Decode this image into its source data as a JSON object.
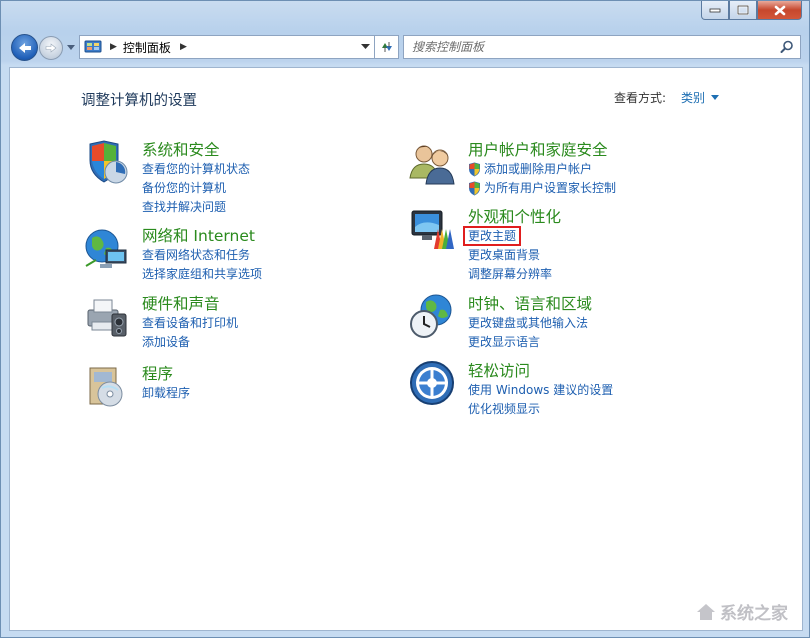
{
  "window": {
    "caption_buttons": [
      "minimize",
      "maximize",
      "close"
    ]
  },
  "nav": {
    "address_path": "控制面板",
    "search_placeholder": "搜索控制面板"
  },
  "header": {
    "title": "调整计算机的设置",
    "view_by_label": "查看方式:",
    "view_by_value": "类别"
  },
  "categories_left": [
    {
      "title": "系统和安全",
      "icon": "system-security-icon",
      "links": [
        "查看您的计算机状态",
        "备份您的计算机",
        "查找并解决问题"
      ]
    },
    {
      "title": "网络和 Internet",
      "icon": "network-icon",
      "links": [
        "查看网络状态和任务",
        "选择家庭组和共享选项"
      ]
    },
    {
      "title": "硬件和声音",
      "icon": "hardware-sound-icon",
      "links": [
        "查看设备和打印机",
        "添加设备"
      ]
    },
    {
      "title": "程序",
      "icon": "programs-icon",
      "links": [
        "卸载程序"
      ]
    }
  ],
  "categories_right": [
    {
      "title": "用户帐户和家庭安全",
      "icon": "user-accounts-icon",
      "links": [
        "添加或删除用户帐户",
        "为所有用户设置家长控制"
      ]
    },
    {
      "title": "外观和个性化",
      "icon": "appearance-icon",
      "links": [
        "更改主题",
        "更改桌面背景",
        "调整屏幕分辨率"
      ]
    },
    {
      "title": "时钟、语言和区域",
      "icon": "clock-language-icon",
      "links": [
        "更改键盘或其他输入法",
        "更改显示语言"
      ]
    },
    {
      "title": "轻松访问",
      "icon": "ease-of-access-icon",
      "links": [
        "使用 Windows 建议的设置",
        "优化视频显示"
      ]
    }
  ],
  "watermark": "系统之家",
  "colors": {
    "link": "#1e5fb0",
    "category_title": "#2a8a1d",
    "highlight": "#e01e1e"
  }
}
